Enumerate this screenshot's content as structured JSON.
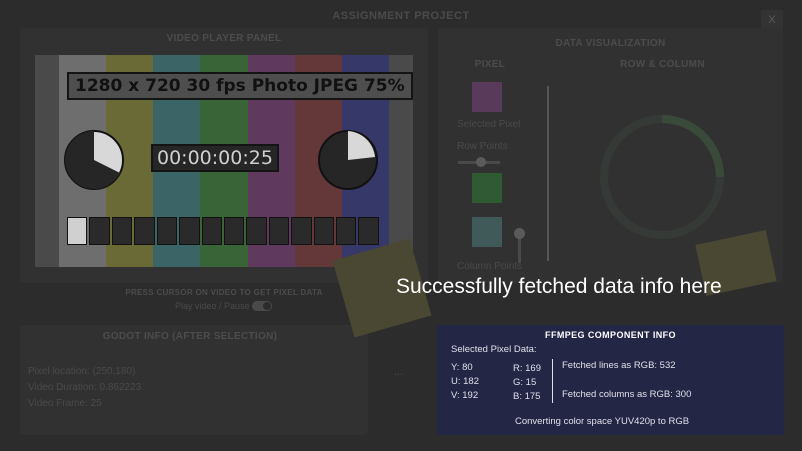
{
  "app": {
    "title": "ASSIGNMENT PROJECT",
    "close_label": "X"
  },
  "video_panel": {
    "title": "VIDEO PLAYER PANEL",
    "overlay_text": "1280 x 720 30 fps Photo JPEG 75%",
    "timecode": "00:00:00:25",
    "hint": "PRESS CURSOR ON VIDEO TO GET PIXEL DATA",
    "toggle_label": "Play video / Pause"
  },
  "godot_info": {
    "title": "GODOT INFO (AFTER SELECTION)",
    "lines": [
      "Pixel location: (250,180)",
      "Video Duration: 0.862223",
      "Video Frame: 25"
    ],
    "more_label": "..."
  },
  "data_viz": {
    "title": "DATA VISUALIZATION",
    "pixel_title": "PIXEL",
    "row_col_title": "ROW & COLUMN",
    "selected_pixel_label": "Selected Pixel",
    "row_points_label": "Row Points",
    "column_points_label": "Column Points"
  },
  "banner": {
    "text": "Successfully fetched data info here"
  },
  "ffmpeg": {
    "title": "FFMPEG COMPONENT INFO",
    "selected_label": "Selected Pixel Data:",
    "yuv": [
      "Y: 80",
      "U: 182",
      "V: 192"
    ],
    "rgb": [
      "R: 169",
      "G: 15",
      "B: 175"
    ],
    "lines_text": "Fetched lines as RGB: 532",
    "columns_text": "Fetched columns as RGB: 300",
    "conversion_text": "Converting color space YUV420p to RGB"
  },
  "colors": {
    "selected_pixel": "#6a3c6a",
    "green_swatch": "#2f6a3a",
    "teal_swatch": "#4f6d6d",
    "info_panel_bg": "#232644"
  }
}
